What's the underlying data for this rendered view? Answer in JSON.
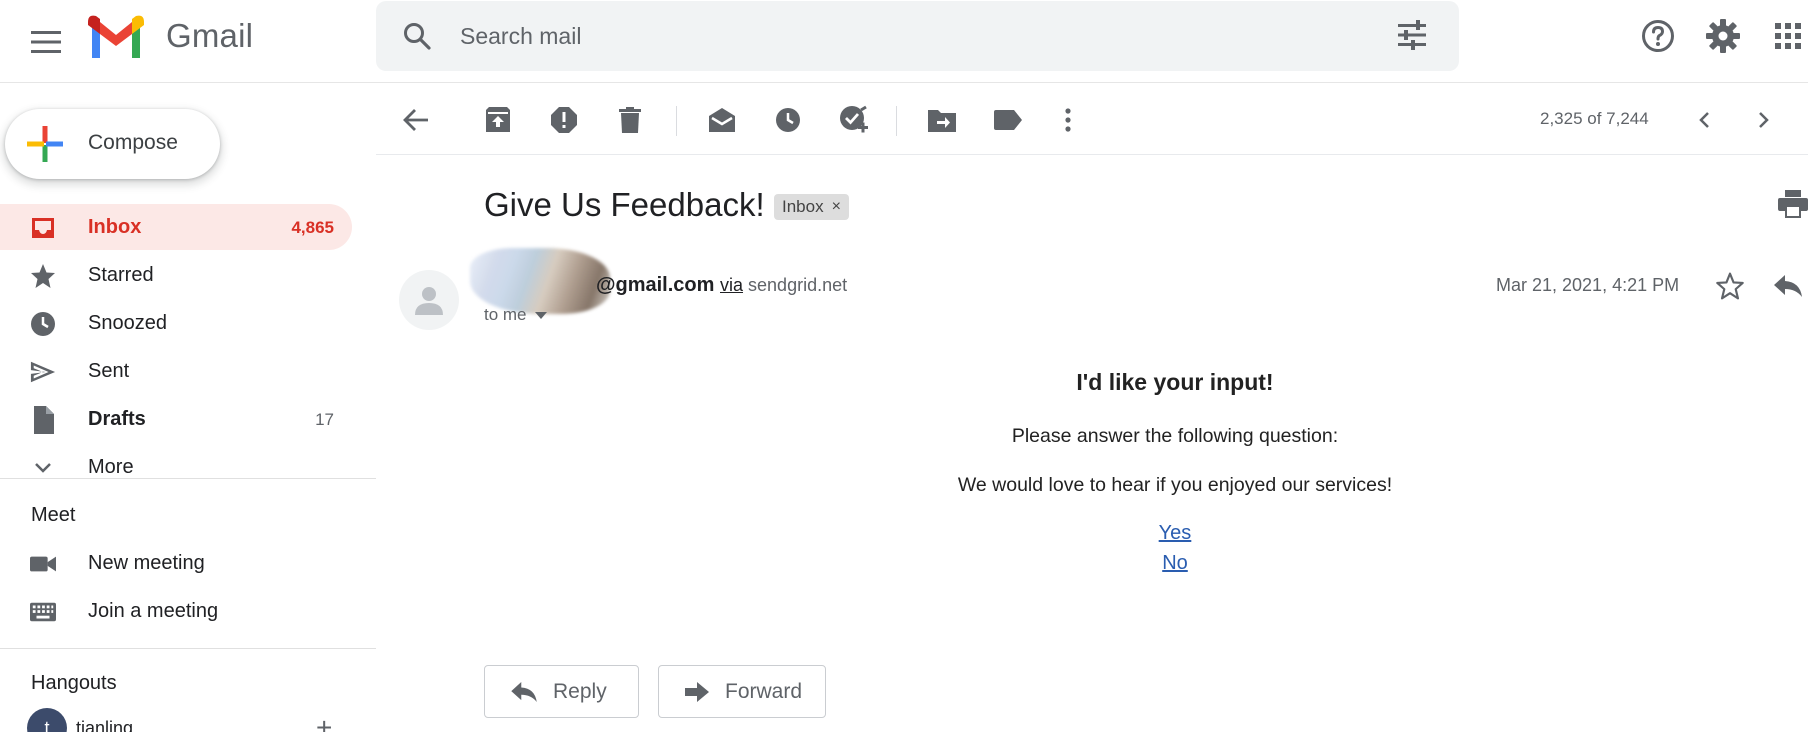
{
  "header": {
    "app_name": "Gmail",
    "search_placeholder": "Search mail"
  },
  "sidebar": {
    "compose_label": "Compose",
    "items": [
      {
        "label": "Inbox",
        "count": "4,865",
        "icon": "inbox-icon"
      },
      {
        "label": "Starred",
        "count": "",
        "icon": "star-icon"
      },
      {
        "label": "Snoozed",
        "count": "",
        "icon": "clock-icon"
      },
      {
        "label": "Sent",
        "count": "",
        "icon": "send-icon"
      },
      {
        "label": "Drafts",
        "count": "17",
        "icon": "draft-icon"
      },
      {
        "label": "More",
        "count": "",
        "icon": "chevron-down-icon"
      }
    ],
    "meet": {
      "title": "Meet",
      "items": [
        {
          "label": "New meeting",
          "icon": "videocam-icon"
        },
        {
          "label": "Join a meeting",
          "icon": "keyboard-icon"
        }
      ]
    },
    "hangouts": {
      "title": "Hangouts",
      "user": {
        "initial": "t",
        "name": "tianling"
      }
    }
  },
  "toolbar": {
    "pager_text": "2,325 of 7,244"
  },
  "message": {
    "subject": "Give Us Feedback!",
    "label_chip": "Inbox",
    "label_chip_close": "×",
    "sender_email": "@gmail.com",
    "via_word": "via",
    "via_domain": "sendgrid.net",
    "to": "to me",
    "date": "Mar 21, 2021, 4:21 PM",
    "body": {
      "title": "I'd like your input!",
      "line1": "Please answer the following question:",
      "line2": "We would love to hear if you enjoyed our services!",
      "link_yes": "Yes",
      "link_no": "No"
    },
    "reply_label": "Reply",
    "forward_label": "Forward"
  },
  "colors": {
    "accent_red": "#d93025",
    "active_bg": "#fce8e6",
    "link_blue": "#2a5db0",
    "icon_gray": "#5f6368"
  }
}
